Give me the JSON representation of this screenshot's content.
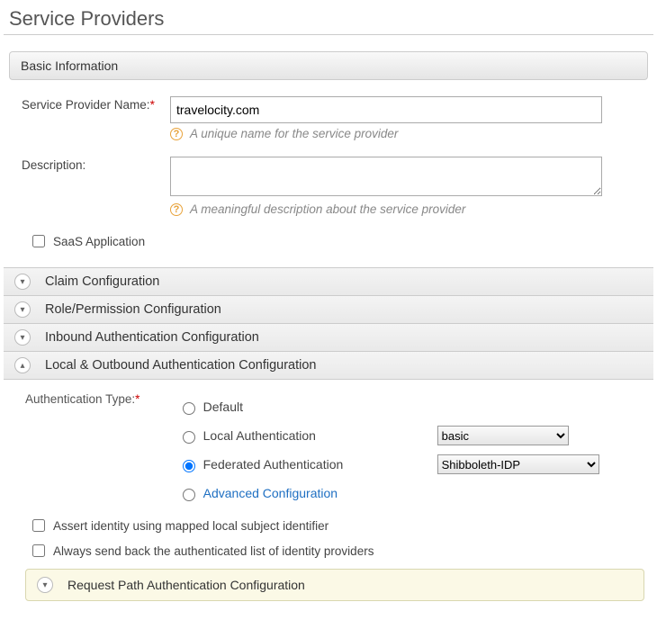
{
  "page_title": "Service Providers",
  "basic_info_header": "Basic Information",
  "sp_name": {
    "label": "Service Provider Name:",
    "value": "travelocity.com",
    "hint": "A unique name for the service provider"
  },
  "description": {
    "label": "Description:",
    "value": "",
    "hint": "A meaningful description about the service provider"
  },
  "saas_label": "SaaS Application",
  "accordions": {
    "claim": "Claim Configuration",
    "role": "Role/Permission Configuration",
    "inbound": "Inbound Authentication Configuration",
    "local_out": "Local & Outbound Authentication Configuration"
  },
  "auth": {
    "type_label": "Authentication Type:",
    "default": "Default",
    "local": "Local Authentication",
    "federated": "Federated Authentication",
    "advanced": "Advanced Configuration",
    "local_select": "basic",
    "fed_select": "Shibboleth-IDP"
  },
  "assert_label": "Assert identity using mapped local subject identifier",
  "always_send_label": "Always send back the authenticated list of identity providers",
  "request_path_header": "Request Path Authentication Configuration"
}
